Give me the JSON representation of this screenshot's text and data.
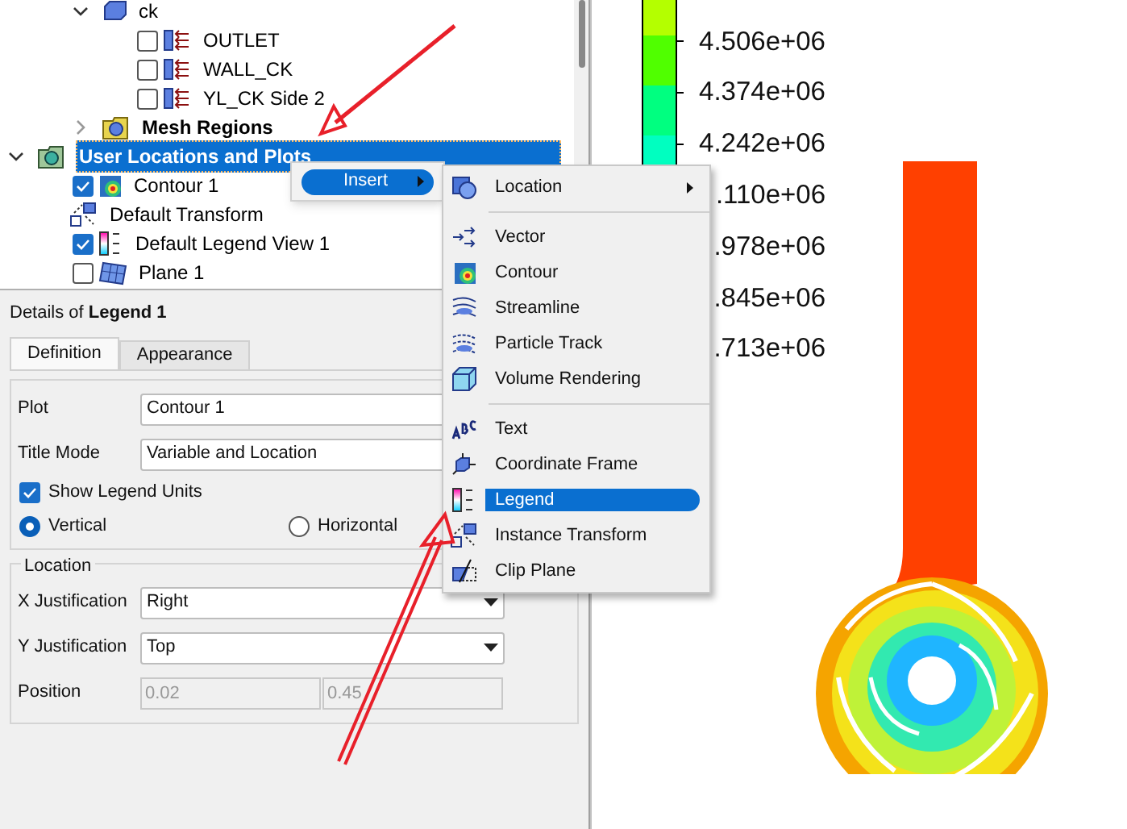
{
  "tree": {
    "items": [
      {
        "children": [
          {
            "label": "ck",
            "kind": "body",
            "expanded": true,
            "children": [
              {
                "label": "OUTLET",
                "kind": "boundary",
                "checked": false
              },
              {
                "label": "WALL_CK",
                "kind": "boundary",
                "checked": false
              },
              {
                "label": "YL_CK Side 2",
                "kind": "boundary",
                "checked": false
              }
            ]
          },
          {
            "label": "Mesh Regions",
            "kind": "mesh-folder",
            "bold": true,
            "expanded": false
          }
        ]
      },
      {
        "label": "User Locations and Plots",
        "kind": "plots-folder",
        "bold": true,
        "expanded": true,
        "selected": true,
        "children": [
          {
            "label": "Contour 1",
            "kind": "contour",
            "checked": true
          },
          {
            "label": "Default Transform",
            "kind": "transform"
          },
          {
            "label": "Default Legend View 1",
            "kind": "legend",
            "checked": true
          },
          {
            "label": "Plane 1",
            "kind": "plane",
            "checked": false
          }
        ]
      }
    ]
  },
  "details": {
    "title": "Details of **Legend 1**",
    "tabs": [
      {
        "label": "Definition",
        "selected": true
      },
      {
        "label": "Appearance",
        "selected": false
      }
    ],
    "plot": {
      "label": "Plot",
      "value": "Contour 1"
    },
    "title_mode": {
      "label": "Title Mode",
      "value": "Variable and Location"
    },
    "show_units": {
      "label": "Show Legend Units",
      "checked": true
    },
    "orientation": [
      {
        "label": "Vertical",
        "selected": true
      },
      {
        "label": "Horizontal",
        "selected": false
      }
    ],
    "location": {
      "title": "Location",
      "x_justification": {
        "label": "X Justification",
        "value": "Right"
      },
      "y_justification": {
        "label": "Y Justification",
        "value": "Top"
      },
      "position": {
        "label": "Position",
        "values": [
          "0.02",
          "0.45"
        ]
      }
    }
  },
  "context_menu": {
    "items": [
      {
        "label": "Insert",
        "selected": true,
        "submenu": true
      }
    ]
  },
  "insert_menu": {
    "items": [
      {
        "kind": "location",
        "label": "Location",
        "submenu": true,
        "selected": false
      },
      {
        "kind": "separator"
      },
      {
        "kind": "vector",
        "label": "Vector",
        "selected": false
      },
      {
        "kind": "contour",
        "label": "Contour",
        "selected": false
      },
      {
        "kind": "streamline",
        "label": "Streamline",
        "selected": false
      },
      {
        "kind": "particle",
        "label": "Particle Track",
        "selected": false
      },
      {
        "kind": "volume",
        "label": "Volume Rendering",
        "selected": false
      },
      {
        "kind": "separator"
      },
      {
        "kind": "text",
        "label": "Text",
        "selected": false
      },
      {
        "kind": "frame",
        "label": "Coordinate Frame",
        "selected": false
      },
      {
        "kind": "legend",
        "label": "Legend",
        "selected": true
      },
      {
        "kind": "transform",
        "label": "Instance Transform",
        "selected": false
      },
      {
        "kind": "clip",
        "label": "Clip Plane",
        "selected": false
      }
    ]
  },
  "legend": {
    "bands": [
      {
        "color": "#b4ff00"
      },
      {
        "color": "#50ff00"
      },
      {
        "color": "#00ff80"
      },
      {
        "color": "#00ffc0"
      }
    ],
    "labels": [
      "4.506e+06",
      "4.374e+06",
      "4.242e+06",
      ".110e+06",
      ".978e+06",
      ".845e+06",
      ".713e+06"
    ]
  }
}
